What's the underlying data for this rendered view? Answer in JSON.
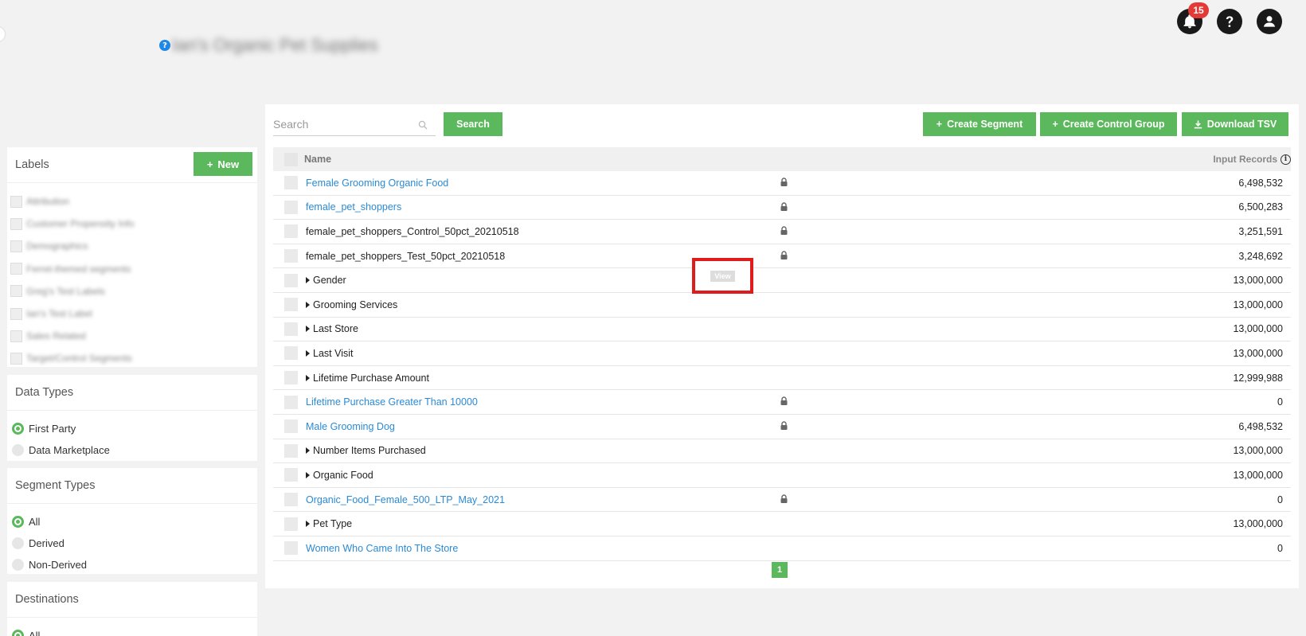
{
  "header": {
    "org_help_icon": "?",
    "org_name": "Ian's Organic Pet Supplies",
    "notification_count": "15",
    "icons": [
      "bell-icon",
      "help-icon",
      "user-icon"
    ]
  },
  "sidebar": {
    "labels": {
      "title": "Labels",
      "new_label": "New",
      "items": [
        "Attribution",
        "Customer Propensity Info",
        "Demographics",
        "Ferret-themed segments",
        "Greg's Test Labels",
        "Ian's Test Label",
        "Sales Related",
        "Target/Control Segments"
      ]
    },
    "data_types": {
      "title": "Data Types",
      "options": [
        {
          "label": "First Party",
          "selected": true
        },
        {
          "label": "Data Marketplace",
          "selected": false
        }
      ]
    },
    "segment_types": {
      "title": "Segment Types",
      "options": [
        {
          "label": "All",
          "selected": true
        },
        {
          "label": "Derived",
          "selected": false
        },
        {
          "label": "Non-Derived",
          "selected": false
        }
      ]
    },
    "destinations": {
      "title": "Destinations",
      "options": [
        {
          "label": "All",
          "selected": true
        }
      ]
    }
  },
  "toolbar": {
    "search_placeholder": "Search",
    "search_button": "Search",
    "create_segment": "Create Segment",
    "create_control_group": "Create Control Group",
    "download_tsv": "Download TSV"
  },
  "table": {
    "col_name": "Name",
    "col_records": "Input Records",
    "view_label": "View",
    "rows": [
      {
        "name": "Female Grooming Organic Food",
        "link": true,
        "expandable": false,
        "locked": true,
        "records": "6,498,532"
      },
      {
        "name": "female_pet_shoppers",
        "link": true,
        "expandable": false,
        "locked": true,
        "records": "6,500,283"
      },
      {
        "name": "female_pet_shoppers_Control_50pct_20210518",
        "link": false,
        "expandable": false,
        "locked": true,
        "records": "3,251,591"
      },
      {
        "name": "female_pet_shoppers_Test_50pct_20210518",
        "link": false,
        "expandable": false,
        "locked": true,
        "records": "3,248,692"
      },
      {
        "name": "Gender",
        "link": false,
        "expandable": true,
        "locked": false,
        "records": "13,000,000"
      },
      {
        "name": "Grooming Services",
        "link": false,
        "expandable": true,
        "locked": false,
        "records": "13,000,000"
      },
      {
        "name": "Last Store",
        "link": false,
        "expandable": true,
        "locked": false,
        "records": "13,000,000"
      },
      {
        "name": "Last Visit",
        "link": false,
        "expandable": true,
        "locked": false,
        "records": "13,000,000"
      },
      {
        "name": "Lifetime Purchase Amount",
        "link": false,
        "expandable": true,
        "locked": false,
        "records": "12,999,988"
      },
      {
        "name": "Lifetime Purchase Greater Than 10000",
        "link": true,
        "expandable": false,
        "locked": true,
        "records": "0"
      },
      {
        "name": "Male Grooming Dog",
        "link": true,
        "expandable": false,
        "locked": true,
        "records": "6,498,532"
      },
      {
        "name": "Number Items Purchased",
        "link": false,
        "expandable": true,
        "locked": false,
        "records": "13,000,000"
      },
      {
        "name": "Organic Food",
        "link": false,
        "expandable": true,
        "locked": false,
        "records": "13,000,000"
      },
      {
        "name": "Organic_Food_Female_500_LTP_May_2021",
        "link": true,
        "expandable": false,
        "locked": true,
        "records": "0"
      },
      {
        "name": "Pet Type",
        "link": false,
        "expandable": true,
        "locked": false,
        "records": "13,000,000"
      },
      {
        "name": "Women Who Came Into The Store",
        "link": true,
        "expandable": false,
        "locked": false,
        "records": "0"
      }
    ]
  },
  "pagination": {
    "current_page": "1"
  },
  "colors": {
    "accent_green": "#5cb85c",
    "link_blue": "#2a8ad6",
    "badge_red": "#e53935",
    "highlight_red": "#e01b1b"
  }
}
